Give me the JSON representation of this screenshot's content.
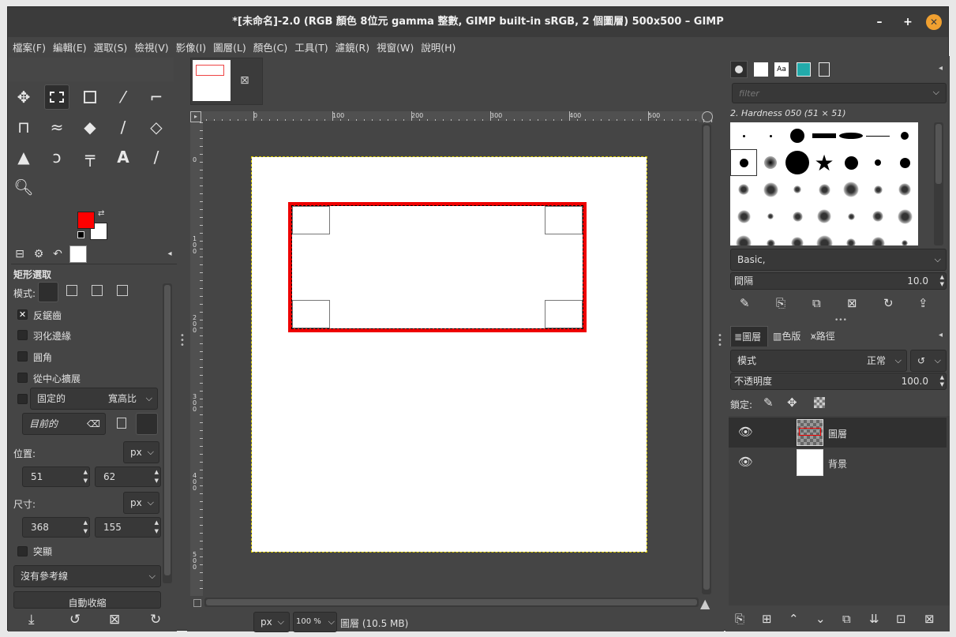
{
  "window": {
    "title": "*[未命名]-2.0 (RGB 顏色 8位元 gamma 整數, GIMP built-in sRGB, 2 個圖層) 500x500 – GIMP",
    "minimize": "–",
    "maximize": "+",
    "close": "✕"
  },
  "menu": [
    "檔案(F)",
    "編輯(E)",
    "選取(S)",
    "檢視(V)",
    "影像(I)",
    "圖層(L)",
    "顏色(C)",
    "工具(T)",
    "濾鏡(R)",
    "視窗(W)",
    "說明(H)"
  ],
  "colors": {
    "foreground": "#ff0000",
    "background": "#ffffff",
    "accent": "#f0a030"
  },
  "tool_options": {
    "title": "矩形選取",
    "mode_label": "模式:",
    "antialias": "反鋸齒",
    "feather": "羽化邊緣",
    "rounded": "圓角",
    "expand_center": "從中心擴展",
    "fixed": "固定的",
    "fixed_value": "寬高比",
    "current": "目前的",
    "position_label": "位置:",
    "unit": "px",
    "pos_x": "51",
    "pos_y": "62",
    "size_label": "尺寸:",
    "size_w": "368",
    "size_h": "155",
    "highlight": "突顯",
    "guides": "沒有參考線",
    "auto_shrink": "自動收縮"
  },
  "canvas": {
    "ruler_h": [
      "0",
      "100",
      "200",
      "300",
      "400",
      "500"
    ],
    "ruler_v": [
      "0",
      "100",
      "200",
      "300",
      "400",
      "500"
    ],
    "unit": "px",
    "zoom": "100 %",
    "status": "圖層 (10.5 MB)"
  },
  "brushes": {
    "filter_placeholder": "filter",
    "current": "2. Hardness 050 (51 × 51)",
    "preset": "Basic,",
    "spacing_label": "間隔",
    "spacing_value": "10.0"
  },
  "layers_panel": {
    "tabs": [
      "圖層",
      "色版",
      "路徑"
    ],
    "mode_label": "模式",
    "mode_value": "正常",
    "opacity_label": "不透明度",
    "opacity_value": "100.0",
    "lock_label": "鎖定:",
    "layers": [
      {
        "name": "圖層",
        "visible": true,
        "selected": true
      },
      {
        "name": "背景",
        "visible": true,
        "selected": false
      }
    ]
  }
}
